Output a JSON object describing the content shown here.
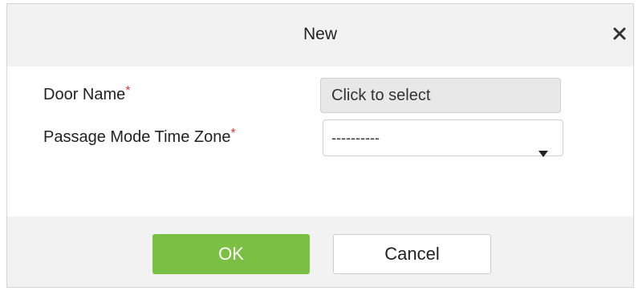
{
  "dialog": {
    "title": "New",
    "close_icon": "close-icon"
  },
  "form": {
    "door_name": {
      "label": "Door Name",
      "required_mark": "*",
      "value": "Click to select"
    },
    "passage_mode_time_zone": {
      "label": "Passage Mode Time Zone",
      "required_mark": "*",
      "value": "----------",
      "icon": "caret-down-icon"
    }
  },
  "footer": {
    "ok_label": "OK",
    "cancel_label": "Cancel"
  },
  "colors": {
    "ok_button": "#7ac143",
    "required_mark": "#e23b3b",
    "header_bg": "#f2f2f2"
  }
}
